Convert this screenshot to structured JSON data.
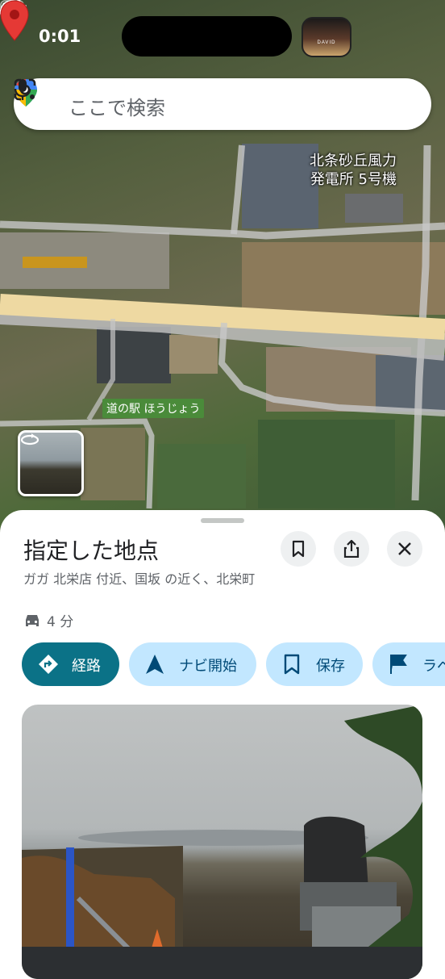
{
  "status_bar": {
    "time": "0:01",
    "album_text": "DAVID"
  },
  "search": {
    "placeholder": "ここで検索"
  },
  "map": {
    "poi_label_line1": "北条砂丘風力",
    "poi_label_line2": "発電所 5号機",
    "station_label": "道の駅 ほうじょう"
  },
  "sheet": {
    "title": "指定した地点",
    "address": "ガガ 北栄店 付近、国坂 の近く、北栄町",
    "drive_time": "4 分",
    "actions": [
      {
        "label": "経路",
        "icon": "directions-icon"
      },
      {
        "label": "ナビ開始",
        "icon": "navigation-arrow-icon"
      },
      {
        "label": "保存",
        "icon": "bookmark-icon"
      },
      {
        "label": "ラベル",
        "icon": "flag-icon"
      }
    ]
  },
  "colors": {
    "accent": "#0b7287",
    "chip_bg": "#c2e7ff",
    "pin_red": "#e53935"
  }
}
